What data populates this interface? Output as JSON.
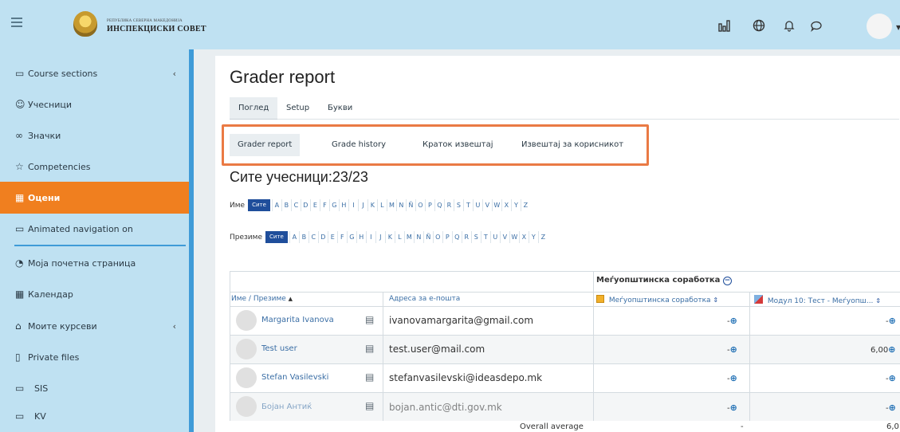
{
  "header": {
    "brand_small": "РЕПУБЛИКА СЕВЕРНА МАКЕДОНИЈА",
    "brand_main": "ИНСПЕКЦИСКИ СОВЕТ",
    "icons": [
      "menu-icon",
      "reports-icon",
      "language-icon",
      "bell-icon",
      "chat-icon",
      "user-avatar"
    ]
  },
  "sidebar": {
    "items": [
      {
        "label": "Course sections",
        "icon": "folder-icon",
        "caret": "‹"
      },
      {
        "label": "Учесници",
        "icon": "users-icon"
      },
      {
        "label": "Значки",
        "icon": "badges-icon"
      },
      {
        "label": "Competencies",
        "icon": "star-icon"
      },
      {
        "label": "Оцени",
        "icon": "grades-icon",
        "active": true
      },
      {
        "label": "Animated navigation on",
        "icon": "folder-icon"
      },
      {
        "label": "Моја почетна страница",
        "icon": "dashboard-icon"
      },
      {
        "label": "Календар",
        "icon": "calendar-icon"
      },
      {
        "label": "Моите курсеви",
        "icon": "courses-icon",
        "caret": "‹"
      },
      {
        "label": "Private files",
        "icon": "file-icon"
      },
      {
        "label": "SIS",
        "icon": "folder-icon"
      },
      {
        "label": "KV",
        "icon": "folder-icon"
      }
    ]
  },
  "main": {
    "title": "Grader report",
    "tabs": [
      "Поглед",
      "Setup",
      "Букви"
    ],
    "subtabs": [
      "Grader report",
      "Grade history",
      "Краток извештај",
      "Извештај за корисникот"
    ],
    "participants": "Сите учесници:23/23",
    "firstname_label": "Име",
    "lastname_label": "Презиме",
    "all_label": "Сите",
    "letters": [
      "A",
      "B",
      "C",
      "D",
      "E",
      "F",
      "G",
      "H",
      "I",
      "J",
      "K",
      "L",
      "M",
      "N",
      "Ñ",
      "O",
      "P",
      "Q",
      "R",
      "S",
      "T",
      "U",
      "V",
      "W",
      "X",
      "Y",
      "Z"
    ]
  },
  "table": {
    "category_header": "Меѓуопштинска соработка",
    "col_name": "Име / Презиме",
    "col_email": "Адреса за е-пошта",
    "col_cat_total": "Меѓуопштинска соработка",
    "col_quiz": "Модул 10: Тест - Меѓуопш...",
    "rows": [
      {
        "name": "Margarita Ivanova",
        "email": "ivanovamargarita@gmail.com",
        "cat": "-",
        "quiz": "-"
      },
      {
        "name": "Test user",
        "email": "test.user@mail.com",
        "cat": "-",
        "quiz": "6,00"
      },
      {
        "name": "Stefan Vasilevski",
        "email": "stefanvasilevski@ideasdepo.mk",
        "cat": "-",
        "quiz": "-"
      },
      {
        "name": "Бојан Антиќ",
        "email": "bojan.antic@dti.gov.mk",
        "cat": "-",
        "quiz": "-"
      }
    ],
    "overall_label": "Overall average",
    "overall_cat": "-",
    "overall_quiz": "6,0"
  }
}
